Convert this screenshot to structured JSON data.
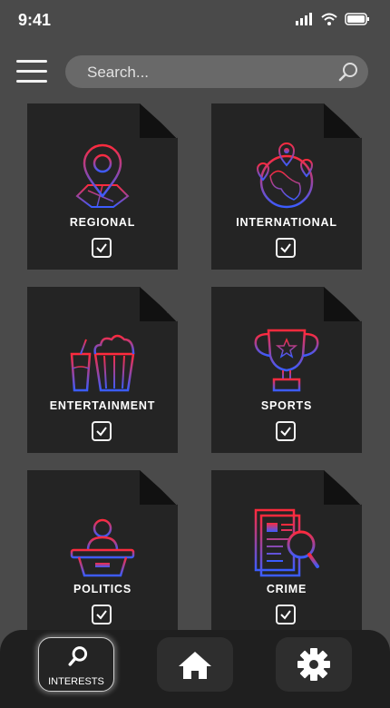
{
  "status_bar": {
    "time": "9:41"
  },
  "header": {
    "search_placeholder": "Search..."
  },
  "categories": [
    {
      "label": "REGIONAL",
      "checked": true
    },
    {
      "label": "INTERNATIONAL",
      "checked": true
    },
    {
      "label": "ENTERTAINMENT",
      "checked": true
    },
    {
      "label": "SPORTS",
      "checked": true
    },
    {
      "label": "POLITICS",
      "checked": true
    },
    {
      "label": "CRIME",
      "checked": true
    }
  ],
  "bottom_nav": {
    "items": [
      {
        "label": "INTERESTS",
        "icon": "search-icon",
        "active": true
      },
      {
        "label": "",
        "icon": "home-icon",
        "active": false
      },
      {
        "label": "",
        "icon": "gear-icon",
        "active": false
      }
    ]
  },
  "colors": {
    "gradient_start": "#ff2a3c",
    "gradient_end": "#3a5cff",
    "background": "#4a4a4a",
    "card": "#242424"
  }
}
